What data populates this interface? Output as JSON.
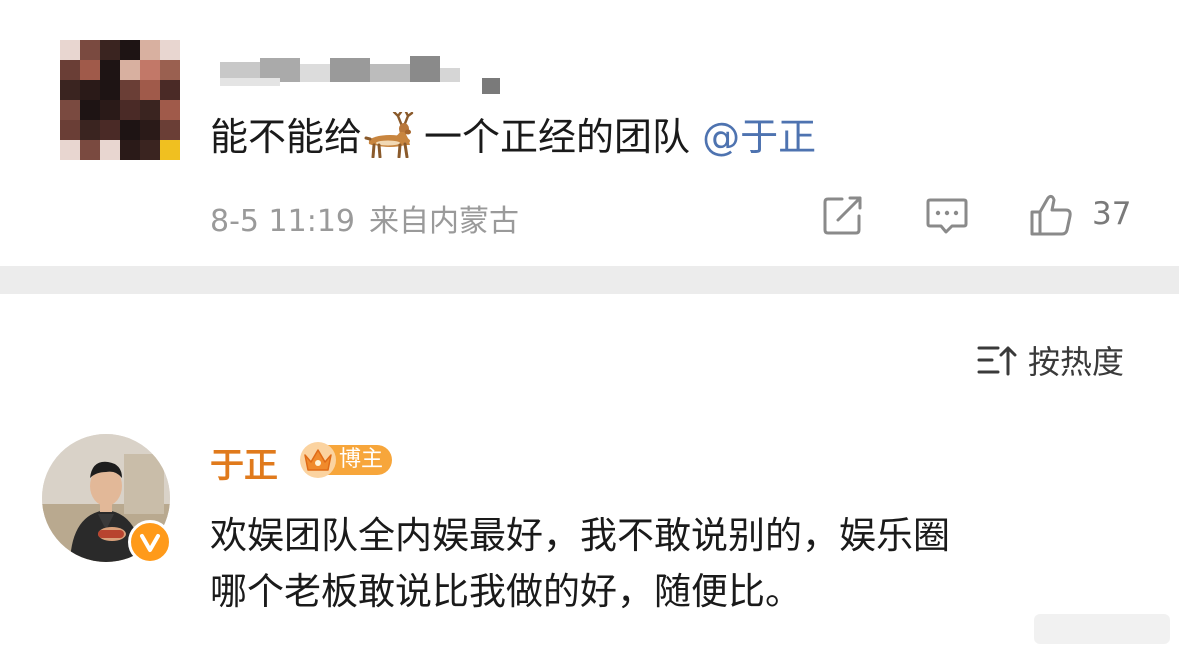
{
  "post": {
    "text_before": "能不能给",
    "text_after": "一个正经的团队",
    "mention": "@于正",
    "time": "8-5 11:19",
    "location": "来自内蒙古",
    "like_count": "37",
    "icons": [
      "share-icon",
      "comment-icon",
      "like-icon",
      "deer-emoji"
    ]
  },
  "sort": {
    "label": "按热度",
    "icon": "sort-icon"
  },
  "reply": {
    "author": "于正",
    "badge": "博主",
    "line1": "欢娱团队全内娱最好，我不敢说别的，娱乐圈",
    "line2": "哪个老板敢说比我做的好，随便比。",
    "icons": [
      "crown-icon",
      "verified-icon"
    ]
  },
  "colors": {
    "mention": "#4e73b0",
    "author_name": "#e07a1c",
    "badge_bg": "#f7a63b",
    "verified": "#ff9a1a",
    "divider": "#ececec"
  }
}
